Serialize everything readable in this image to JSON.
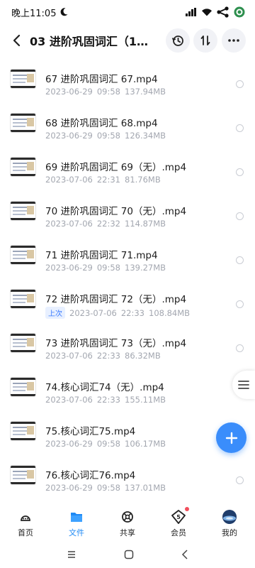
{
  "status": {
    "time": "晚上11:05",
    "icons": [
      "moon-icon",
      "signal-icon",
      "wifi-icon",
      "share-icon",
      "app-icon"
    ]
  },
  "header": {
    "title": "03 进阶巩固词汇（110...",
    "buttons": [
      "back-icon",
      "history-icon",
      "sort-icon",
      "more-icon"
    ]
  },
  "files": [
    {
      "name": "67 进阶巩固词汇 67.mp4",
      "date": "2023-06-29",
      "time": "09:58",
      "size": "137.94MB"
    },
    {
      "name": "68 进阶巩固词汇 68.mp4",
      "date": "2023-06-29",
      "time": "09:58",
      "size": "126.34MB"
    },
    {
      "name": "69 进阶巩固词汇 69（无）.mp4",
      "date": "2023-07-06",
      "time": "22:31",
      "size": "81.76MB"
    },
    {
      "name": "70 进阶巩固词汇 70（无）.mp4",
      "date": "2023-07-06",
      "time": "22:32",
      "size": "114.87MB"
    },
    {
      "name": "71 进阶巩固词汇 71.mp4",
      "date": "2023-06-29",
      "time": "09:58",
      "size": "139.27MB"
    },
    {
      "name": "72 进阶巩固词汇 72（无）.mp4",
      "badge": "上次",
      "date": "2023-07-06",
      "time": "22:33",
      "size": "108.84MB"
    },
    {
      "name": "73 进阶巩固词汇 73（无）.mp4",
      "date": "2023-07-06",
      "time": "22:33",
      "size": "86.32MB"
    },
    {
      "name": "74.核心词汇74（无）.mp4",
      "date": "2023-07-06",
      "time": "22:33",
      "size": "155.11MB"
    },
    {
      "name": "75.核心词汇75.mp4",
      "date": "2023-06-29",
      "time": "09:58",
      "size": "106.17MB"
    },
    {
      "name": "76.核心词汇76.mp4",
      "date": "2023-06-29",
      "time": "09:58",
      "size": "137.01MB"
    }
  ],
  "tabs": [
    {
      "label": "首页",
      "icon": "home-icon"
    },
    {
      "label": "文件",
      "icon": "folder-icon",
      "active": true
    },
    {
      "label": "共享",
      "icon": "share-hub-icon"
    },
    {
      "label": "会员",
      "icon": "vip-icon",
      "badge_text": "5",
      "dot": true
    },
    {
      "label": "我的",
      "icon": "avatar-icon"
    }
  ],
  "colors": {
    "accent": "#1f8af5",
    "fab": "#3a8dfb",
    "meta": "#a3a7b0"
  }
}
